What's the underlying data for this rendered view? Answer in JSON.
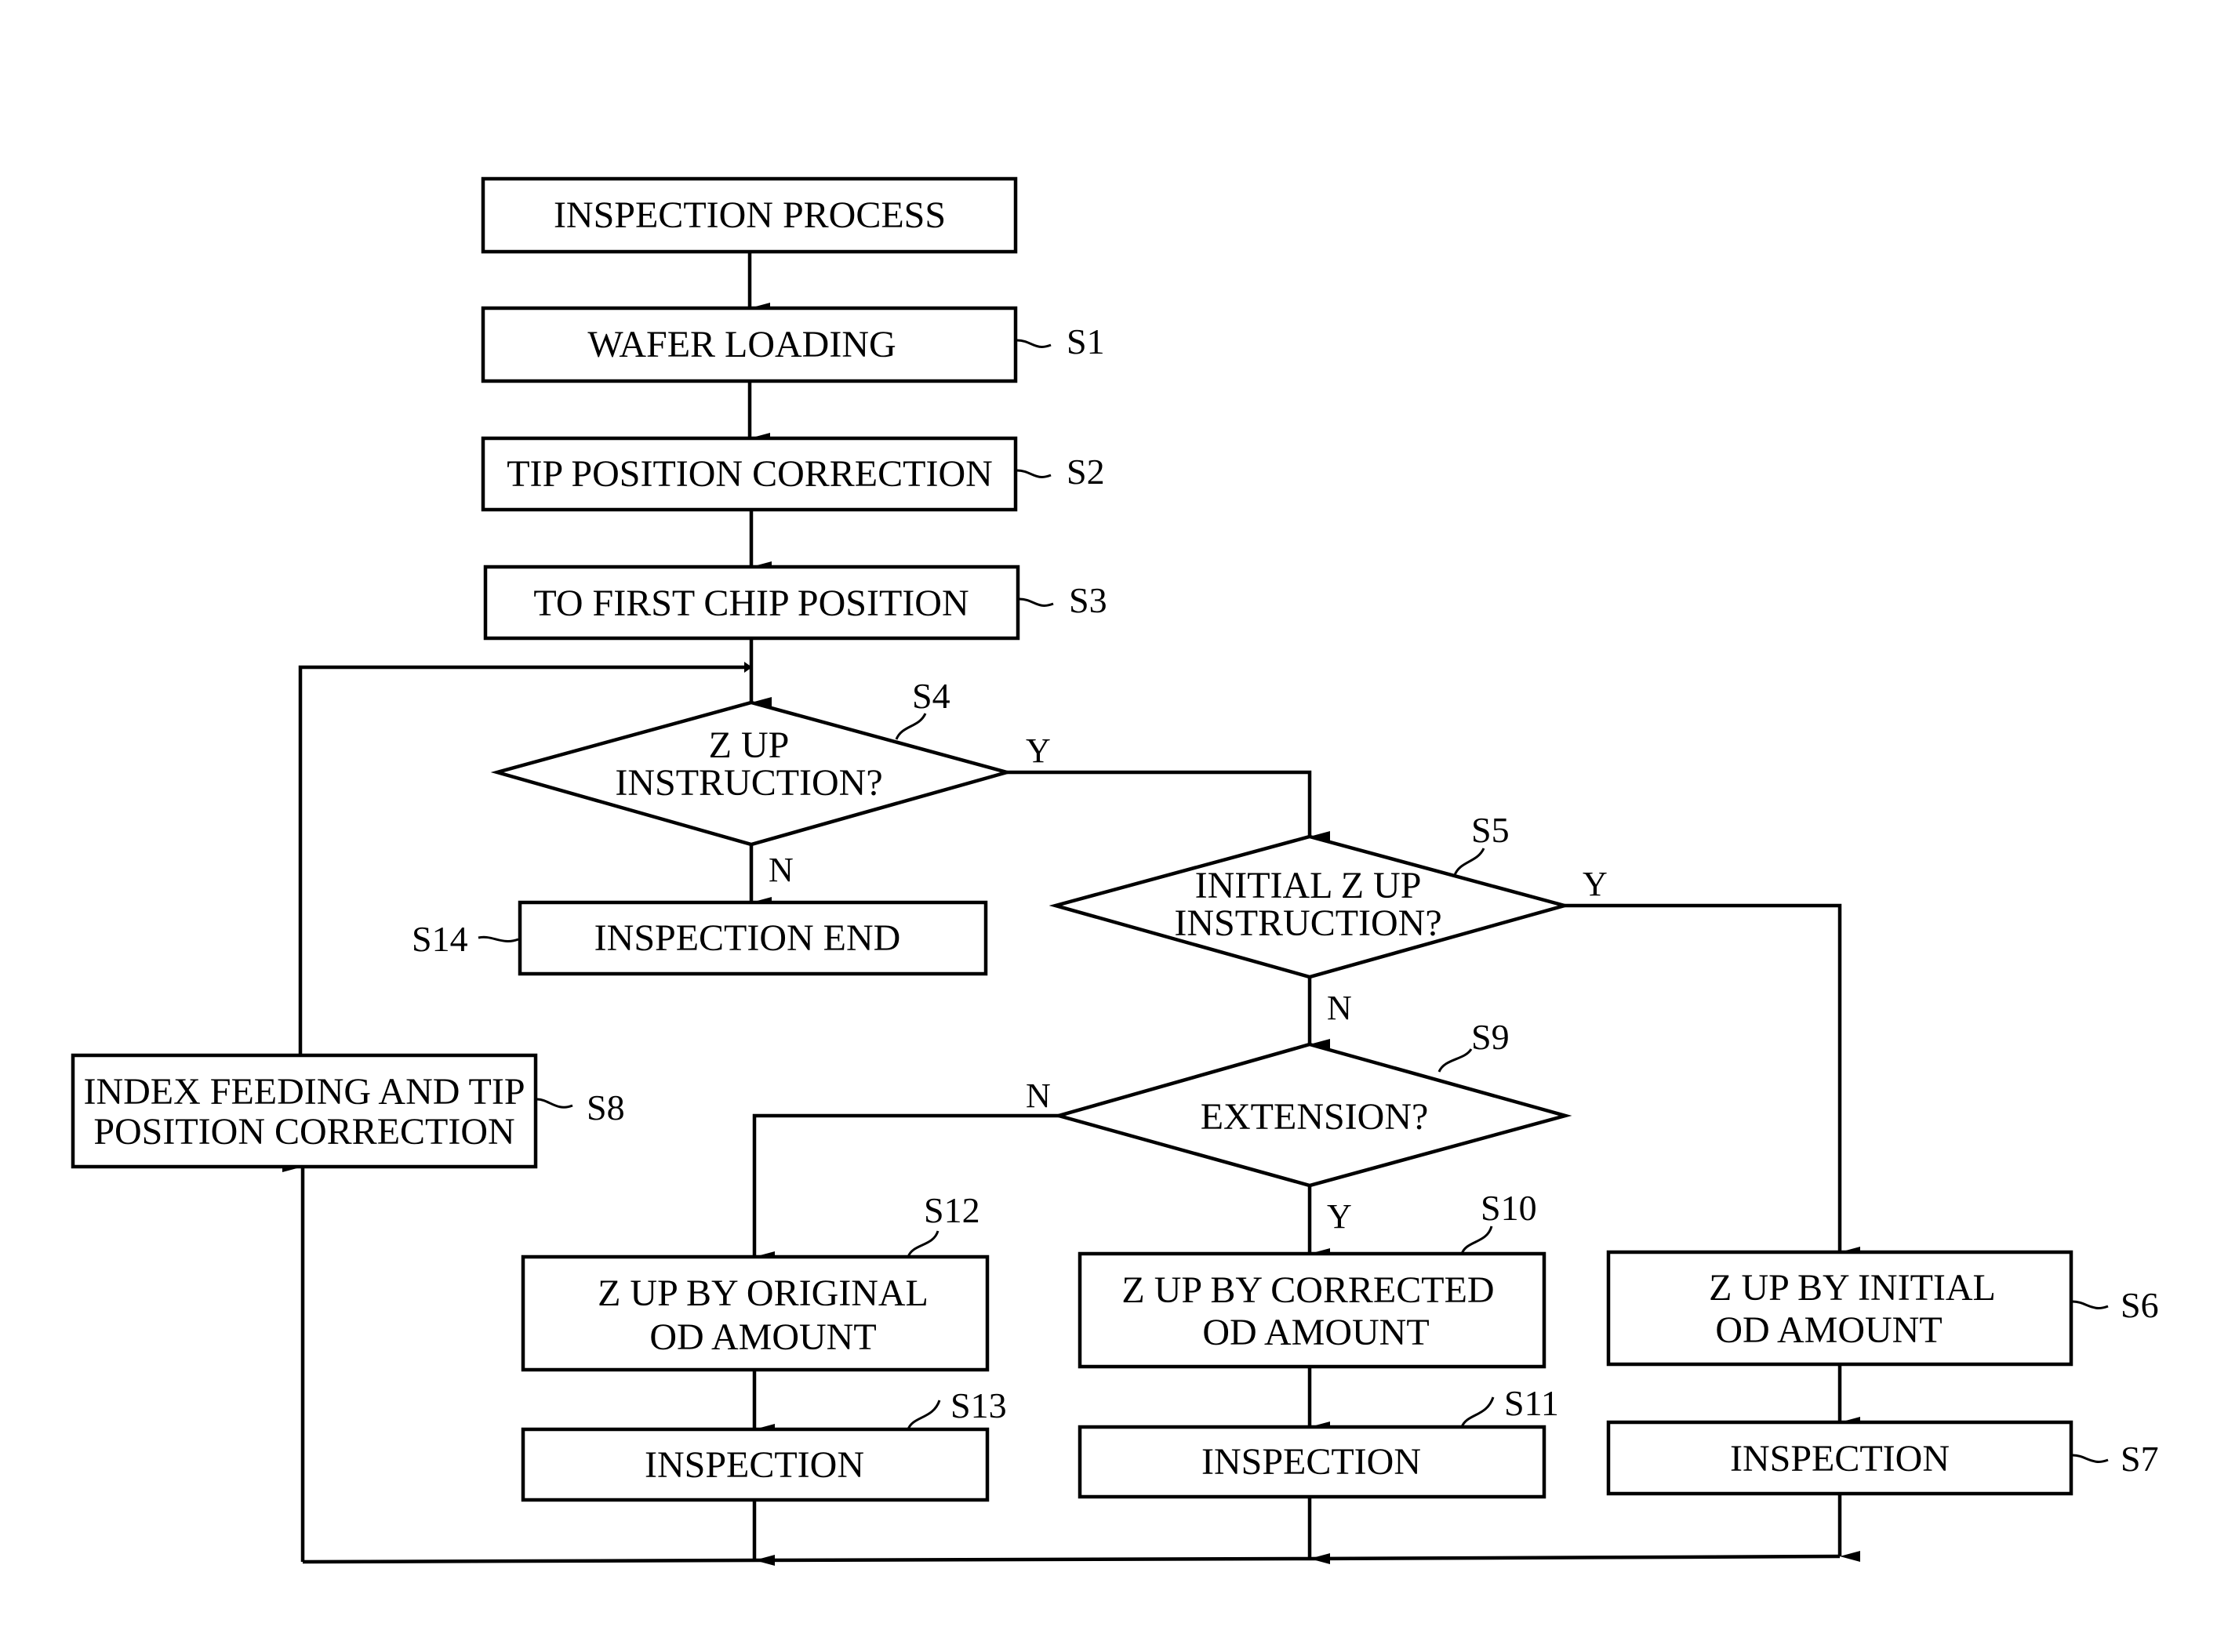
{
  "diagram": {
    "type": "flowchart",
    "title": "INSPECTION PROCESS",
    "nodes": {
      "start": {
        "text": [
          "INSPECTION PROCESS"
        ],
        "step": ""
      },
      "s1": {
        "text": [
          "WAFER LOADING"
        ],
        "step": "S1"
      },
      "s2": {
        "text": [
          "TIP POSITION CORRECTION"
        ],
        "step": "S2"
      },
      "s3": {
        "text": [
          "TO FIRST CHIP POSITION"
        ],
        "step": "S3"
      },
      "s4": {
        "text": [
          "Z UP",
          "INSTRUCTION?"
        ],
        "step": "S4",
        "shape": "decision"
      },
      "s5": {
        "text": [
          "INITIAL Z  UP",
          "INSTRUCTION?"
        ],
        "step": "S5",
        "shape": "decision"
      },
      "s6": {
        "text": [
          "Z UP BY INITIAL",
          "OD AMOUNT"
        ],
        "step": "S6"
      },
      "s7": {
        "text": [
          "INSPECTION"
        ],
        "step": "S7"
      },
      "s8": {
        "text": [
          "INDEX FEEDING AND TIP",
          "POSITION CORRECTION"
        ],
        "step": "S8"
      },
      "s9": {
        "text": [
          "EXTENSION?"
        ],
        "step": "S9",
        "shape": "decision"
      },
      "s10": {
        "text": [
          "Z UP BY CORRECTED",
          "OD AMOUNT"
        ],
        "step": "S10"
      },
      "s11": {
        "text": [
          "INSPECTION"
        ],
        "step": "S11"
      },
      "s12": {
        "text": [
          "Z UP BY ORIGINAL",
          "OD AMOUNT"
        ],
        "step": "S12"
      },
      "s13": {
        "text": [
          "INSPECTION"
        ],
        "step": "S13"
      },
      "s14": {
        "text": [
          "INSPECTION END"
        ],
        "step": "S14"
      }
    },
    "edges": [
      {
        "from": "start",
        "to": "s1",
        "label": ""
      },
      {
        "from": "s1",
        "to": "s2",
        "label": ""
      },
      {
        "from": "s2",
        "to": "s3",
        "label": ""
      },
      {
        "from": "s3",
        "to": "s4",
        "label": ""
      },
      {
        "from": "s4",
        "to": "s5",
        "label": "Y"
      },
      {
        "from": "s4",
        "to": "s14",
        "label": "N"
      },
      {
        "from": "s5",
        "to": "s6",
        "label": "Y"
      },
      {
        "from": "s5",
        "to": "s9",
        "label": "N"
      },
      {
        "from": "s9",
        "to": "s10",
        "label": "Y"
      },
      {
        "from": "s9",
        "to": "s12",
        "label": "N"
      },
      {
        "from": "s6",
        "to": "s7",
        "label": ""
      },
      {
        "from": "s10",
        "to": "s11",
        "label": ""
      },
      {
        "from": "s12",
        "to": "s13",
        "label": ""
      },
      {
        "from": "s7",
        "to": "s8",
        "label": ""
      },
      {
        "from": "s11",
        "to": "s8",
        "label": ""
      },
      {
        "from": "s13",
        "to": "s8",
        "label": ""
      },
      {
        "from": "s8",
        "to": "s4",
        "label": ""
      }
    ],
    "edge_labels": {
      "yes": "Y",
      "no": "N"
    }
  }
}
